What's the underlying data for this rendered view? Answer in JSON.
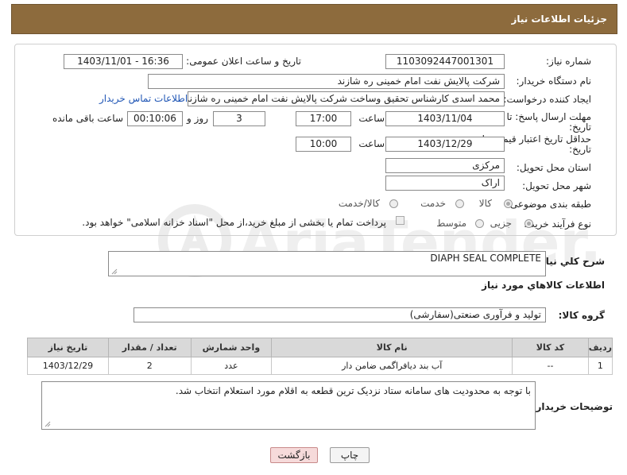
{
  "header": {
    "title": "جزئیات اطلاعات نیاز"
  },
  "form": {
    "need_number_label": "شماره نیاز:",
    "need_number": "1103092447001301",
    "announce_label": "تاریخ و ساعت اعلان عمومی:",
    "announce_value": "1403/11/01 - 16:36",
    "buyer_org_label": "نام دستگاه خریدار:",
    "buyer_org": "شرکت پالایش نفت امام خمینی  ره  شازند",
    "creator_label": "ایجاد کننده درخواست:",
    "creator": "محمد اسدی کارشناس تحقیق وساخت شرکت پالایش نفت امام خمینی  ره  شازند",
    "contact_link": "اطلاعات تماس خریدار",
    "deadline_label_1": "مهلت ارسال پاسخ: تا",
    "deadline_label_2": "تاریخ:",
    "deadline_date": "1403/11/04",
    "time_label": "ساعت",
    "deadline_time": "17:00",
    "days_value": "3",
    "days_label": "روز و",
    "remaining_value": "00:10:06",
    "remaining_label": "ساعت باقی مانده",
    "validity_label_1": "حداقل تاریخ اعتبار قیمت: تا",
    "validity_label_2": "تاریخ:",
    "validity_date": "1403/12/29",
    "validity_time_label": "ساعت",
    "validity_time": "10:00",
    "province_label": "استان محل تحویل:",
    "province": "مرکزی",
    "city_label": "شهر محل تحویل:",
    "city": "اراک",
    "category_label": "طبقه بندی موضوعی:",
    "category_options": [
      "کالا",
      "خدمت",
      "کالا/خدمت"
    ],
    "process_label": "نوع فرآیند خرید :",
    "process_options": [
      "جزیی",
      "متوسط"
    ],
    "payment_note": "پرداخت تمام یا بخشی از مبلغ خرید،از محل \"اسناد خزانه اسلامی\" خواهد بود."
  },
  "description": {
    "label": "شرح كلي نياز:",
    "value": "DIAPH SEAL COMPLETE"
  },
  "goods": {
    "section_title": "اطلاعات كالاهاي مورد نياز",
    "group_label": "گروه کالا:",
    "group_value": "تولید و فرآوری صنعتی(سفارشی)",
    "columns": [
      "ردیف",
      "کد کالا",
      "نام کالا",
      "واحد شمارش",
      "تعداد / مقدار",
      "تاریخ نیاز"
    ],
    "rows": [
      [
        "1",
        "--",
        "آب بند دیافراگمی ضامن دار",
        "عدد",
        "2",
        "1403/12/29"
      ]
    ]
  },
  "buyer_notes": {
    "label": "توضیحات خریدار:",
    "value": "با توجه به محدودیت های سامانه ستاد نزدیک ترین قطعه به اقلام مورد استعلام انتخاب شد."
  },
  "buttons": {
    "print": "چاپ",
    "back": "بازگشت"
  },
  "watermark": {
    "text": "AriaTender.net"
  },
  "colors": {
    "header_bg": "#8d6b3d",
    "link": "#2056b5",
    "back_button_bg": "#f6dada"
  }
}
